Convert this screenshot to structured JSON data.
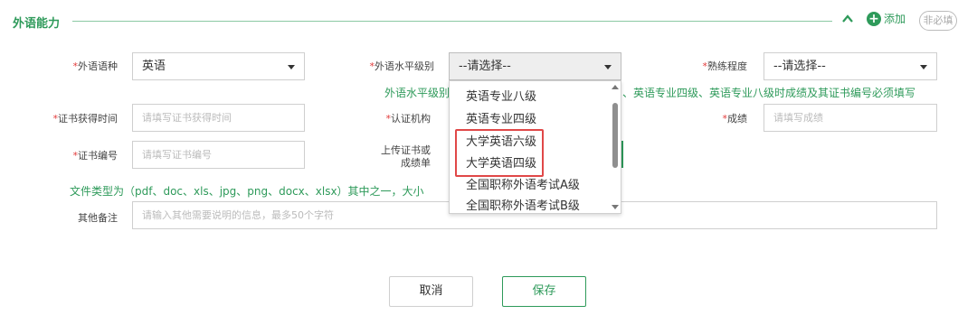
{
  "section": {
    "title": "外语能力",
    "add_label": "添加",
    "optional_badge": "非必填"
  },
  "form": {
    "language": {
      "label": "外语语种",
      "value": "英语"
    },
    "level": {
      "label": "外语水平级别",
      "value": "--请选择--"
    },
    "proficiency": {
      "label": "熟练程度",
      "value": "--请选择--"
    },
    "level_hint_prefix": "外语水平级别",
    "level_hint_suffix": "、英语专业四级、英语专业八级时成绩及其证书编号必须填写",
    "cert_time": {
      "label": "证书获得时间",
      "placeholder": "请填写证书获得时间"
    },
    "cert_org": {
      "label": "认证机构"
    },
    "score": {
      "label": "成绩",
      "placeholder": "请填写成绩"
    },
    "cert_no": {
      "label": "证书编号",
      "placeholder": "请填写证书编号"
    },
    "upload": {
      "label_line1": "上传证书或",
      "label_line2": "成绩单"
    },
    "file_hint": "文件类型为（pdf、doc、xls、jpg、png、docx、xlsx）其中之一，大小",
    "remarks": {
      "label": "其他备注",
      "placeholder": "请输入其他需要说明的信息，最多50个字符"
    }
  },
  "dropdown": {
    "options": [
      "英语专业八级",
      "英语专业四级",
      "大学英语六级",
      "大学英语四级",
      "全国职称外语考试A级",
      "全国职称外语考试B级"
    ],
    "highlighted": [
      "大学英语六级",
      "大学英语四级"
    ]
  },
  "buttons": {
    "cancel": "取消",
    "save": "保存"
  },
  "colors": {
    "accent": "#2e9a5a",
    "required": "#e23a3a",
    "highlight_border": "#e04848"
  }
}
